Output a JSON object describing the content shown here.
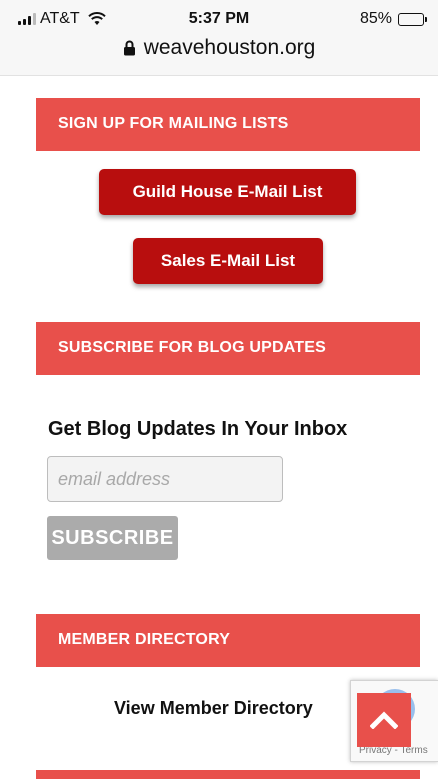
{
  "status_bar": {
    "carrier": "AT&T",
    "time": "5:37 PM",
    "battery": "85%",
    "battery_level": 0.85,
    "url": "weavehouston.org"
  },
  "sections": {
    "mailing": "SIGN UP FOR MAILING LISTS",
    "blog": "SUBSCRIBE FOR BLOG UPDATES",
    "directory": "MEMBER DIRECTORY"
  },
  "buttons": {
    "guild": "Guild House E-Mail List",
    "sales": "Sales E-Mail List"
  },
  "blog": {
    "heading": "Get Blog Updates In Your Inbox",
    "placeholder": "email address",
    "subscribe": "SUBSCRIBE"
  },
  "directory": {
    "link": "View Member Directory"
  },
  "recaptcha": {
    "text": "Privacy - Terms"
  },
  "colors": {
    "section_bg": "#e8504b",
    "button_bg": "#b80e0e",
    "subscribe_bg": "#ababab"
  }
}
